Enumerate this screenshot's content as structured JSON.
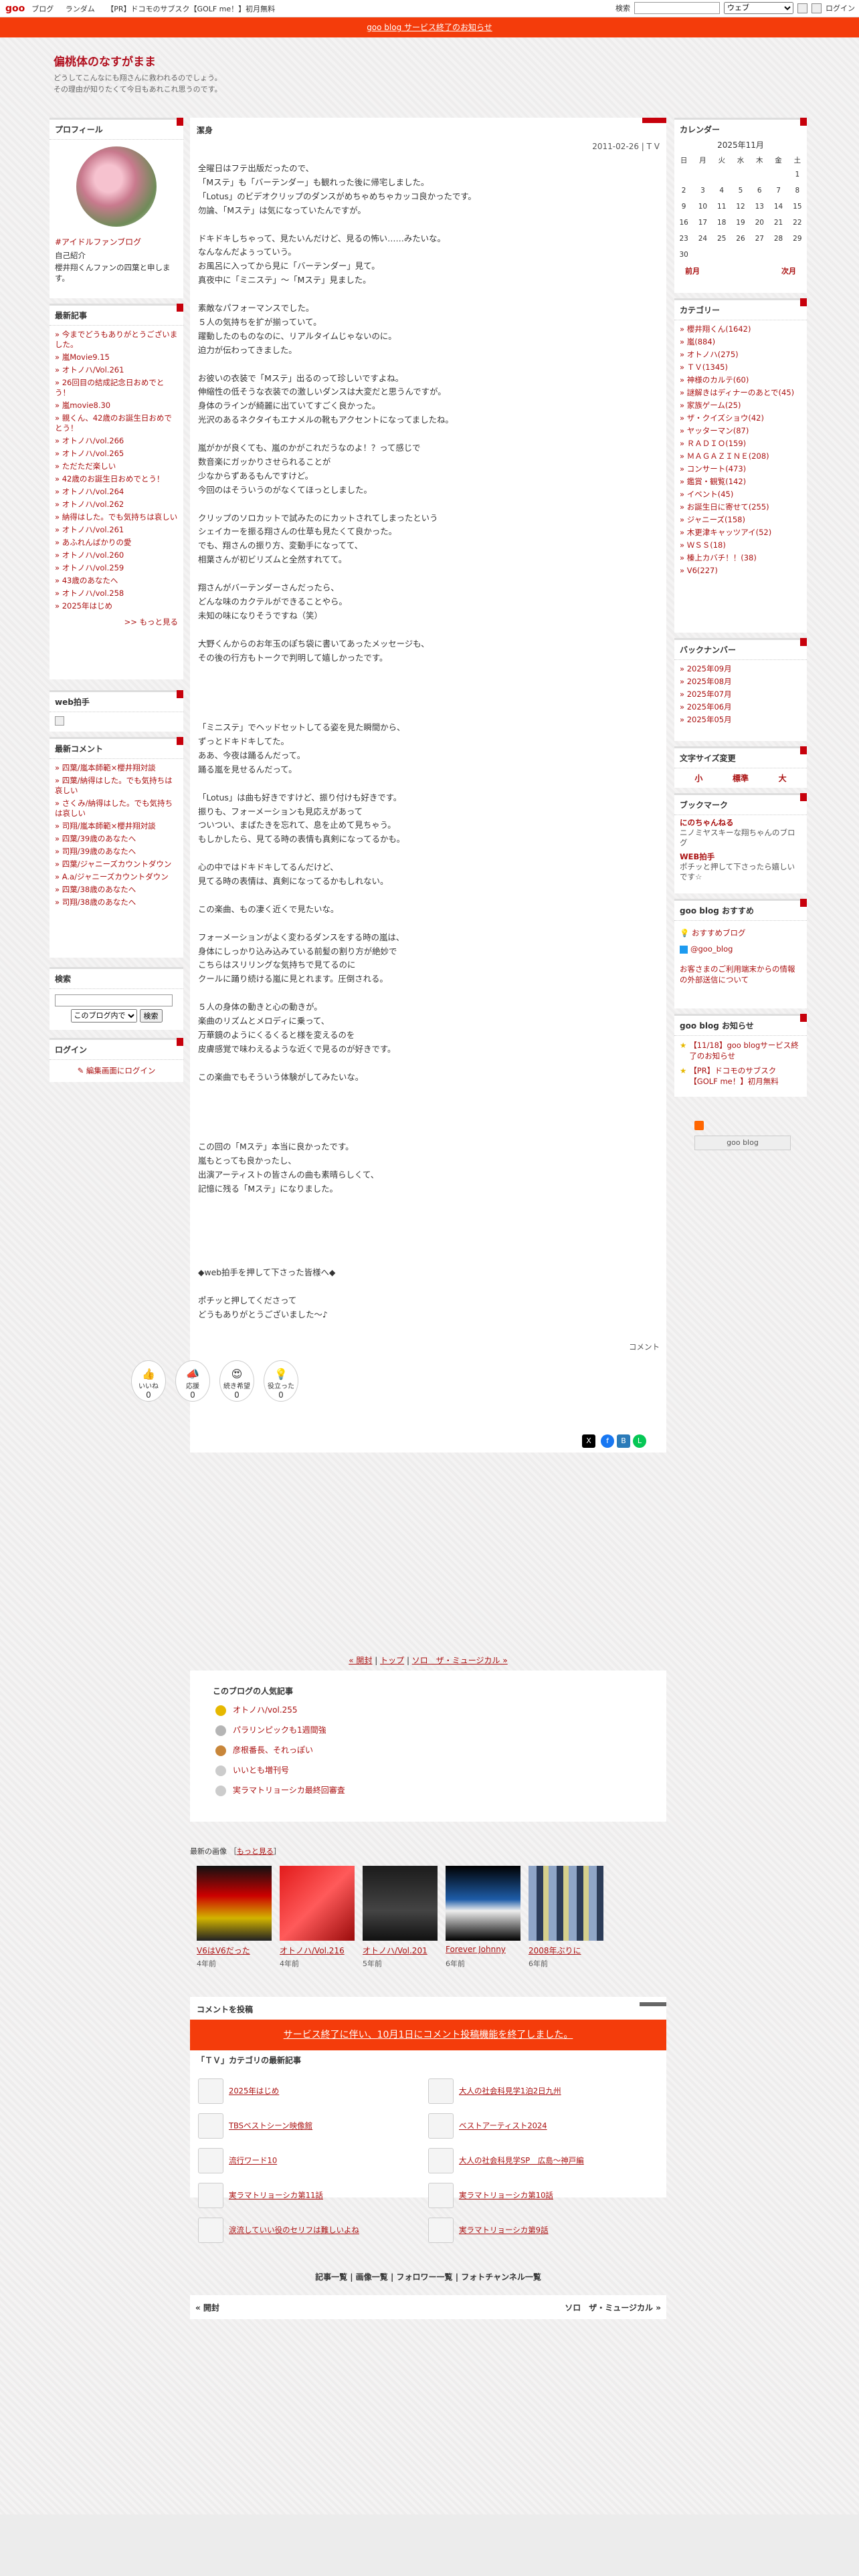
{
  "topbar": {
    "logo": "goo",
    "nav": [
      "ブログ",
      "ランダム",
      "【PR】ドコモのサブスク【GOLF me！】初月無料"
    ],
    "search_label": "検索",
    "search_select": "ウェブ",
    "login": "ログイン"
  },
  "notice": "goo blog サービス終了のお知らせ",
  "blog": {
    "title": "偏桃体のなすがまま",
    "desc1": "どうしてこんなにも翔さんに救われるのでしょう。",
    "desc2": "その理由が知りたくて今日もあれこれ思うのです。"
  },
  "profile": {
    "title": "プロフィール",
    "link": "#アイドルファンブログ",
    "intro_title": "自己紹介",
    "intro": "櫻井翔くんファンの四葉と申します。"
  },
  "recent_posts": {
    "title": "最新記事",
    "items": [
      "今までどうもありがとうございました。",
      "嵐Movie9.15",
      "オトノハ/Vol.261",
      "26回目の結成記念日おめでとう！",
      "嵐movie8.30",
      "親くん、42歳のお誕生日おめでとう！",
      "オトノハ/vol.266",
      "オトノハ/vol.265",
      "ただただ楽しい",
      "42歳のお誕生日おめでとう！",
      "オトノハ/vol.264",
      "オトノハ/vol.262",
      "納得はした。でも気持ちは哀しい",
      "オトノハ/vol.261",
      "あふれんばかりの愛",
      "オトノハ/vol.260",
      "オトノハ/vol.259",
      "43歳のあなたへ",
      "オトノハ/vol.258",
      "2025年はじめ"
    ],
    "more": ">> もっと見る"
  },
  "webclap": {
    "title": "web拍手"
  },
  "recent_comments": {
    "title": "最新コメント",
    "items": [
      "四葉/嵐本師範×櫻井翔対談",
      "四葉/納得はした。でも気持ちは哀しい",
      "さくみ/納得はした。でも気持ちは哀しい",
      "司翔/嵐本師範×櫻井翔対談",
      "四葉/39歳のあなたへ",
      "司翔/39歳のあなたへ",
      "四葉/ジャニーズカウントダウン",
      "A.a/ジャニーズカウントダウン",
      "四葉/38歳のあなたへ",
      "司翔/38歳のあなたへ"
    ]
  },
  "search": {
    "title": "検索",
    "select": "このブログ内で",
    "button": "検索"
  },
  "login": {
    "title": "ログイン",
    "link": "編集画面にログイン"
  },
  "post": {
    "title": "潔身",
    "date": "2011-02-26 | T V",
    "lines": [
      "全曜日はフテ出版だったので、",
      "「Mステ」も「バーテンダー」も観れった後に帰宅しました。",
      "「Lotus」のビデオクリップのダンスがめちゃめちゃカッコ良かったです。",
      "勿論、「Mステ」は気になっていたんですが。",
      "",
      "ドキドキしちゃって、見たいんだけど、見るの怖い……みたいな。",
      "なんなんだよぅっていう。",
      "お風呂に入ってから見に「バーテンダー」見て。",
      "真夜中に「ミニステ」～「Mステ」見ました。",
      "",
      "素敵なパフォーマンスでした。",
      "５人の気持ちを扩が揃っていて。",
      "躍動したのものなのに、リアルタイムじゃないのに。",
      "迫力が伝わってきました。",
      "",
      "お彼いの衣装で「Mステ」出るのって珍しいですよね。",
      "伸縮性の低そうな衣装での激しいダンスは大変だと思うんですが。",
      "身体のラインが綺麗に出ていてすごく良かった。",
      "光沢のあるネクタイもエナメルの靴もアクセントになってましたね。",
      "",
      "嵐がかが良くても、嵐のかがこれだうなのよ！？って感じで",
      "数音楽にガッかりさせられることが",
      "少なからずあるもんですけど。",
      "今回のはそういうのがなくてほっとしました。",
      "",
      "クリップのソロカットで試みたのにカットされてしまったという",
      "シェイカーを振る翔さんの仕草も見たくて良かった。",
      "でも、翔さんの振り方、変動手になってて、",
      "相葉さんが初ビリズムと全然すれてて。",
      "",
      "翔さんがバーテンダーさんだったら、",
      "どんな味のカクテルができることやら。",
      "未知の味になりそうですね（笑）",
      "",
      "大野くんからのお年玉のぽち袋に書いてあったメッセージも、",
      "その後の行方もトークで判明して嬉しかったです。",
      "",
      "",
      "",
      "",
      "「ミニステ」でヘッドセットしてる姿を見た瞬間から、",
      "ずっとドキドキしてた。",
      "ああ、今夜は踊るんだって。",
      "踊る嵐を見せるんだって。",
      "",
      "「Lotus」は曲も好きですけど、振り付けも好きです。",
      "振りも、フォーメーションも見応えがあって",
      "ついつい、まばたきを忘れて、息を止めて見ちゃう。",
      "もしかしたら、見てる時の表情も真剣になってるかも。",
      "",
      "心の中ではドキドキしてるんだけど、",
      "見てる時の表情は、真剣になってるかもしれない。",
      "",
      "この楽曲、もの凄く近くで見たいな。",
      "",
      "フォーメーションがよく変わるダンスをする時の嵐は、",
      "身体にしっかり込み込みている前髪の割り方が絶妙で",
      "こちらはスリリングな気持ちで見てるのに",
      "クールに踊り続ける嵐に見とれます。圧倒される。",
      "",
      "５人の身体の動きと心の動きが。",
      "楽曲のリズムとメロディに乗って、",
      "万華鏡のようにくるくると様を変えるのを",
      "皮膚感覚で味わえるような近くで見るのが好きです。",
      "",
      "この楽曲でもそういう体験がしてみたいな。",
      "",
      "",
      "",
      "",
      "この回の「Mステ」本当に良かったです。",
      "嵐もとっても良かったし、",
      "出演アーティストの皆さんの曲も素晴らしくて、",
      "記憶に残る「Mステ」になりました。",
      "",
      "",
      "",
      "",
      "",
      "◆web拍手を押して下さった皆様へ◆",
      "",
      "ポチッと押してくださって",
      "どうもありがとうございました～♪"
    ],
    "comment_label": "コメント"
  },
  "reactions": [
    {
      "label": "いいね",
      "count": "0"
    },
    {
      "label": "応援",
      "count": "0"
    },
    {
      "label": "続き希望",
      "count": "0"
    },
    {
      "label": "役立った",
      "count": "0"
    }
  ],
  "calendar": {
    "title": "カレンダー",
    "month": "2025年11月",
    "days": [
      "日",
      "月",
      "火",
      "水",
      "木",
      "金",
      "土"
    ],
    "rows": [
      [
        "",
        "",
        "",
        "",
        "",
        "",
        "1"
      ],
      [
        "2",
        "3",
        "4",
        "5",
        "6",
        "7",
        "8"
      ],
      [
        "9",
        "10",
        "11",
        "12",
        "13",
        "14",
        "15"
      ],
      [
        "16",
        "17",
        "18",
        "19",
        "20",
        "21",
        "22"
      ],
      [
        "23",
        "24",
        "25",
        "26",
        "27",
        "28",
        "29"
      ],
      [
        "30",
        "",
        "",
        "",
        "",
        "",
        ""
      ]
    ],
    "prev": "前月",
    "next": "次月"
  },
  "categories": {
    "title": "カテゴリー",
    "items": [
      "櫻井翔くん(1642)",
      "嵐(884)",
      "オトノハ(275)",
      "ＴＶ(1345)",
      "神様のカルテ(60)",
      "謎解きはディナーのあとで(45)",
      "家族ゲーム(25)",
      "ザ・クイズショウ(42)",
      "ヤッターマン(87)",
      "ＲＡＤＩＯ(159)",
      "ＭＡＧＡＺＩＮＥ(208)",
      "コンサート(473)",
      "鑑賞・観覧(142)",
      "イベント(45)",
      "お誕生日に寄せて(255)",
      "ジャニーズ(158)",
      "木更津キャッツアイ(52)",
      "ＷＳＳ(18)",
      "榛上カバチ！！(38)",
      "V6(227)"
    ]
  },
  "backnumber": {
    "title": "バックナンバー",
    "items": [
      "2025年09月",
      "2025年08月",
      "2025年07月",
      "2025年06月",
      "2025年05月"
    ]
  },
  "fontsize": {
    "title": "文字サイズ変更",
    "small": "小",
    "normal": "標準",
    "large": "大"
  },
  "bookmarks": {
    "title": "ブックマーク",
    "items": [
      {
        "name": "にのちゃんねる",
        "desc": "ニノミヤスキーな翔ちゃんのブログ"
      },
      {
        "name": "WEB拍手",
        "desc": "ポチッと押して下さったら嬉しいです☆"
      }
    ]
  },
  "goo_recommend": {
    "title": "goo blog おすすめ",
    "items": [
      "おすすめブログ",
      "@goo_blog"
    ],
    "notice": "お客さまのご利用端末からの情報の外部送信について"
  },
  "goo_news": {
    "title": "goo blog お知らせ",
    "items": [
      "【11/18】goo blogサービス終了のお知らせ",
      "【PR】ドコモのサブスク【GOLF me！】初月無料"
    ]
  },
  "goo_badge": "goo blog",
  "pnav": {
    "prev": "« 開封",
    "top": "トップ",
    "next": "ソロ　ザ・ミュージカル »"
  },
  "popular": {
    "title": "このブログの人気記事",
    "items": [
      "オトノハ/vol.255",
      "パラリンピックも1週間強",
      "彦根番長、それっぽい",
      "いいとも増刊号",
      "実ラマトリョーシカ最終回審査"
    ]
  },
  "recent_images": {
    "title": "最新の画像",
    "more": "もっと見る",
    "items": [
      {
        "cap": "V6はV6だった",
        "year": "4年前"
      },
      {
        "cap": "オトノハ/Vol.216",
        "year": "4年前"
      },
      {
        "cap": "オトノハ/Vol.201",
        "year": "5年前"
      },
      {
        "cap": "Forever Johnny",
        "year": "6年前"
      },
      {
        "cap": "2008年ぶりに",
        "year": "6年前"
      }
    ]
  },
  "compost": {
    "title": "コメントを投稿",
    "banner": "サービス終了に伴い、10月1日にコメント投稿機能を終了しました。",
    "cat_title": "「ＴＶ」カテゴリの最新記事",
    "items": [
      "2025年はじめ",
      "大人の社会科見学1泊2日九州",
      "TBSベストシーン映像館",
      "ベストアーティスト2024",
      "流行ワード10",
      "大人の社会科見学SP　広島～神戸編",
      "実ラマトリョーシカ第11話",
      "実ラマトリョーシカ第10話",
      "涙流していい役のセリフは難しいよね",
      "実ラマトリョーシカ第9話"
    ]
  },
  "footnav": "記事一覧 | 画像一覧 | フォロワー一覧 | フォトチャンネル一覧",
  "prevnext": {
    "prev": "« 開封",
    "next": "ソロ　ザ・ミュージカル »"
  }
}
